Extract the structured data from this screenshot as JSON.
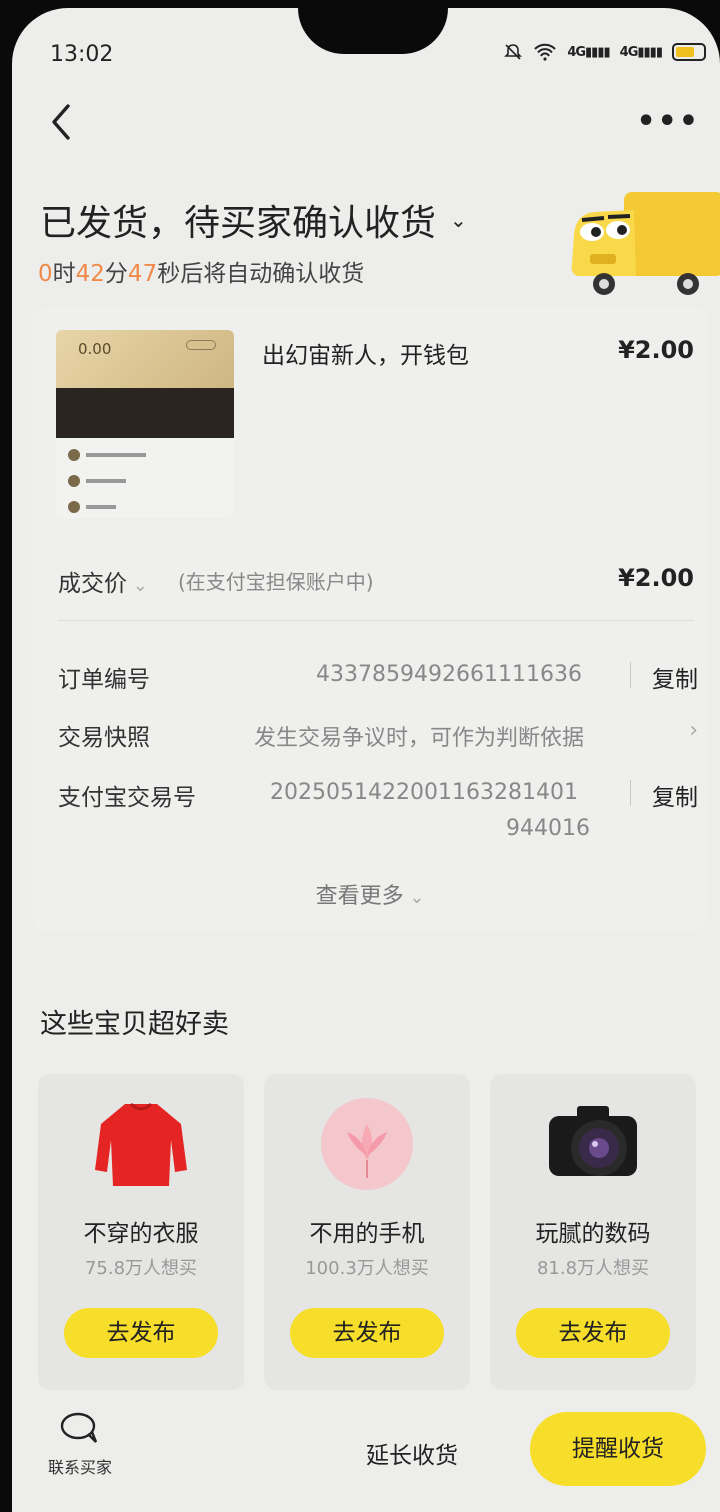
{
  "status_bar": {
    "time": "13:02",
    "signal1": "4G",
    "signal2": "4G"
  },
  "header": {
    "more_label": "•••"
  },
  "order_status": {
    "title": "已发货，待买家确认收货",
    "countdown": {
      "h": "0",
      "h_unit": "时",
      "m": "42",
      "m_unit": "分",
      "s": "47",
      "s_suffix": "秒后将自动确认收货"
    }
  },
  "product": {
    "title": "出幻宙新人，开钱包",
    "price": "¥2.00",
    "thumb_balance": "0.00"
  },
  "deal": {
    "label": "成交价",
    "note": "(在支付宝担保账户中)",
    "price": "¥2.00"
  },
  "order_info": {
    "order_no_label": "订单编号",
    "order_no": "4337859492661111636",
    "copy_label": "复制",
    "snapshot_label": "交易快照",
    "snapshot_value": "发生交易争议时，可作为判断依据",
    "alipay_label": "支付宝交易号",
    "alipay_no_line1": "2025051422001163281401",
    "alipay_no_line2": "944016",
    "copy_label2": "复制",
    "see_more": "查看更多"
  },
  "recommend": {
    "title": "这些宝贝超好卖",
    "items": [
      {
        "name": "不穿的衣服",
        "want": "75.8万人想买",
        "button": "去发布",
        "icon": "sweater-icon"
      },
      {
        "name": "不用的手机",
        "want": "100.3万人想买",
        "button": "去发布",
        "icon": "phone-flower-icon"
      },
      {
        "name": "玩腻的数码",
        "want": "81.8万人想买",
        "button": "去发布",
        "icon": "camera-icon"
      }
    ]
  },
  "bottom": {
    "contact_label": "联系买家",
    "extend_label": "延长收货",
    "remind_label": "提醒收货"
  },
  "colors": {
    "accent": "#f6de2a",
    "countdown": "#f08a4a"
  }
}
